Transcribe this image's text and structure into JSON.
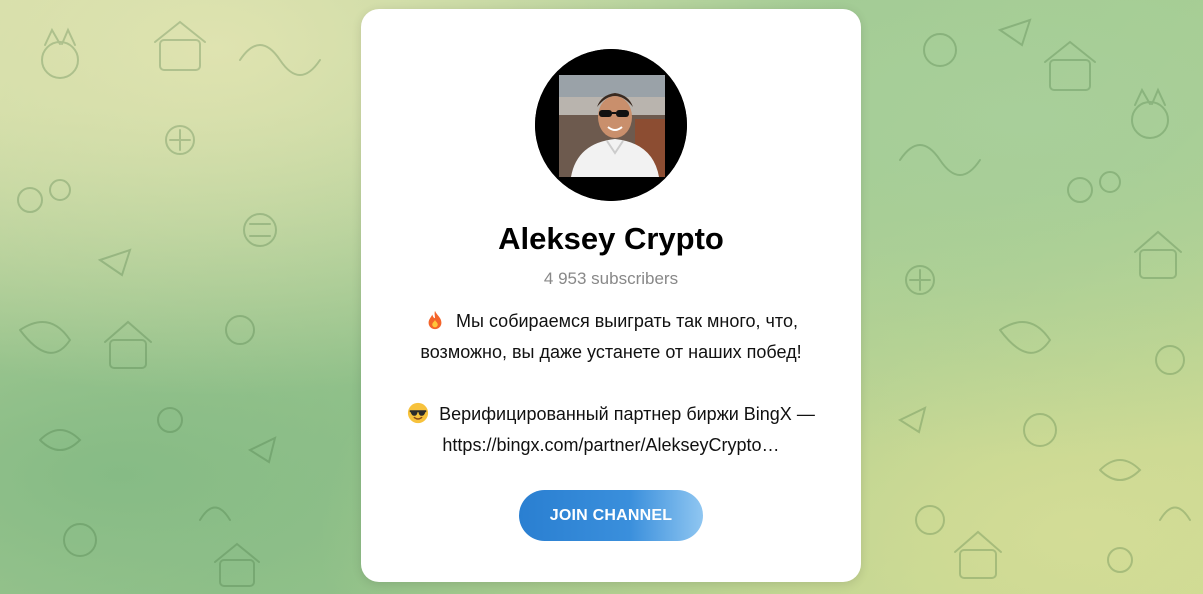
{
  "channel": {
    "title": "Aleksey Crypto",
    "subscribers": "4 953 subscribers",
    "avatar_icon": "profile-photo-avatar"
  },
  "description": {
    "line1_emoji": "fire-emoji",
    "line1": "Мы собираемся выиграть так много, что,",
    "line2": "возможно, вы даже устанете от наших побед!",
    "line3_emoji": "sunglasses-emoji",
    "line3": "Верифицированный партнер биржи BingX —",
    "line4": "https://bingx.com/partner/AlekseyCrypto…"
  },
  "actions": {
    "join_label": "JOIN CHANNEL"
  },
  "colors": {
    "button_start": "#2a7fd1",
    "button_end": "#8fc6f1",
    "subscribers_text": "#888888"
  }
}
